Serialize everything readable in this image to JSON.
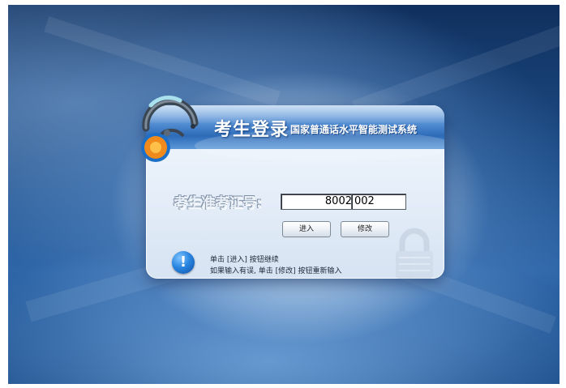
{
  "dialog": {
    "title": "考生登录",
    "subtitle": "国家普通话水平智能测试系统",
    "id_label": "考生准考证号:",
    "id_prefix_value": "8002",
    "id_suffix_value": "002",
    "enter_label": "进入",
    "modify_label": "修改",
    "info_mark": "!",
    "hint_line_1": "单击 [进入] 按钮继续",
    "hint_line_2": "如果输入有误, 单击 [修改] 按钮重新输入"
  },
  "colors": {
    "header_blue": "#2d6bb8",
    "info_blue": "#2a86e0",
    "headset_orange": "#f08a1c",
    "background_navy": "#1d4c86"
  },
  "icons": [
    "headset-icon",
    "info-icon",
    "lock-icon"
  ]
}
